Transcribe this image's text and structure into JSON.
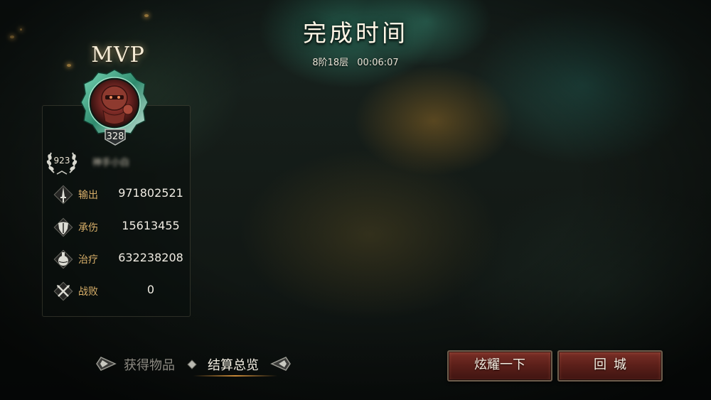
{
  "header": {
    "title": "完成时间",
    "floor": "8阶18层",
    "time": "00:06:07"
  },
  "mvp": {
    "label": "MVP",
    "portrait_icon": "armored-hero-portrait",
    "level": "328",
    "rank": "923",
    "player_name": "神手小白"
  },
  "stats": [
    {
      "icon": "sword-icon",
      "label": "输出",
      "value": "971802521"
    },
    {
      "icon": "shield-icon",
      "label": "承伤",
      "value": "15613455"
    },
    {
      "icon": "potion-icon",
      "label": "治疗",
      "value": "632238208"
    },
    {
      "icon": "crossed-swords-icon",
      "label": "战败",
      "value": "0"
    }
  ],
  "tabs": {
    "items": [
      "获得物品",
      "结算总览"
    ],
    "active": "结算总览"
  },
  "buttons": {
    "share": "炫耀一下",
    "return": "回城"
  },
  "colors": {
    "stat_label": "#d9b06a",
    "button_red": "#6a2620",
    "accent_gold": "#dc963c"
  }
}
